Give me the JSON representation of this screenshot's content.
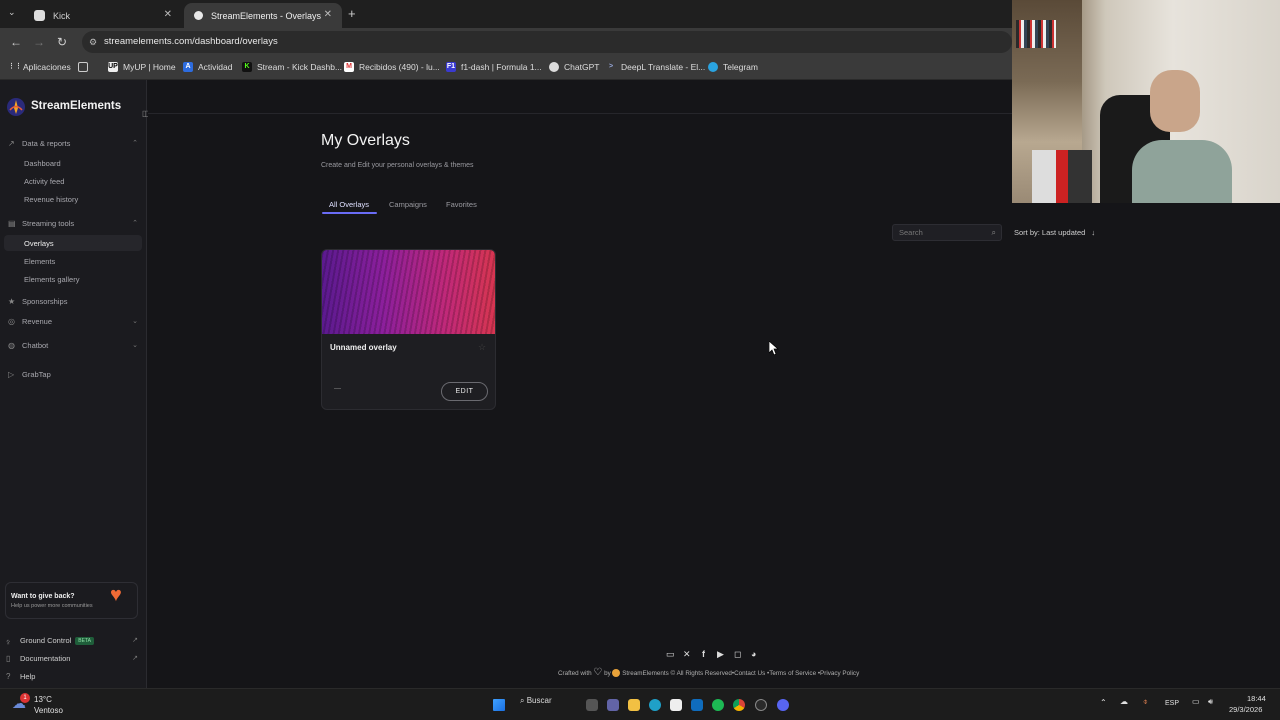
{
  "browser": {
    "tabs": [
      {
        "label": "Kick"
      },
      {
        "label": "StreamElements - Overlays"
      }
    ],
    "url": "streamelements.com/dashboard/overlays",
    "bookmarks": [
      {
        "label": "Aplicaciones"
      },
      {
        "label": "MyUP | Home"
      },
      {
        "label": "Actividad"
      },
      {
        "label": "Stream - Kick Dashb..."
      },
      {
        "label": "Recibidos (490) - lu..."
      },
      {
        "label": "f1-dash | Formula 1..."
      },
      {
        "label": "ChatGPT"
      },
      {
        "label": "DeepL Translate - El..."
      },
      {
        "label": "Telegram"
      }
    ]
  },
  "sidebar": {
    "brand": "StreamElements",
    "sections": {
      "data_reports": "Data & reports",
      "dashboard": "Dashboard",
      "activity_feed": "Activity feed",
      "revenue_history": "Revenue history",
      "streaming_tools": "Streaming tools",
      "overlays": "Overlays",
      "elements": "Elements",
      "elements_gallery": "Elements gallery",
      "sponsorships": "Sponsorships",
      "revenue": "Revenue",
      "chatbot": "Chatbot",
      "grabtap": "GrabTap"
    },
    "giveback": {
      "title": "Want to give back?",
      "subtitle": "Help us power more communities"
    },
    "footer_links": {
      "ground_control": "Ground Control",
      "beta": "BETA",
      "documentation": "Documentation",
      "help": "Help"
    }
  },
  "main": {
    "title": "My Overlays",
    "subtitle": "Create and Edit your personal overlays & themes",
    "tabs": [
      {
        "label": "All Overlays"
      },
      {
        "label": "Campaigns"
      },
      {
        "label": "Favorites"
      }
    ],
    "search_placeholder": "Search",
    "sort_label": "Sort by: Last updated",
    "card": {
      "name": "Unnamed overlay",
      "edit_label": "EDIT",
      "dash": "—"
    }
  },
  "footer": {
    "crafted": "Crafted with",
    "by": "by",
    "brand": "StreamElements",
    "rights": "© All Rights Reserved",
    "contact": "•Contact Us",
    "terms": "•Terms of Service",
    "privacy": "•Privacy Policy"
  },
  "taskbar": {
    "weather_temp": "13°C",
    "weather_desc": "Ventoso",
    "search": "Buscar",
    "lang": "ESP",
    "time": "18:44",
    "date": "29/3/2026",
    "notif": "1"
  }
}
